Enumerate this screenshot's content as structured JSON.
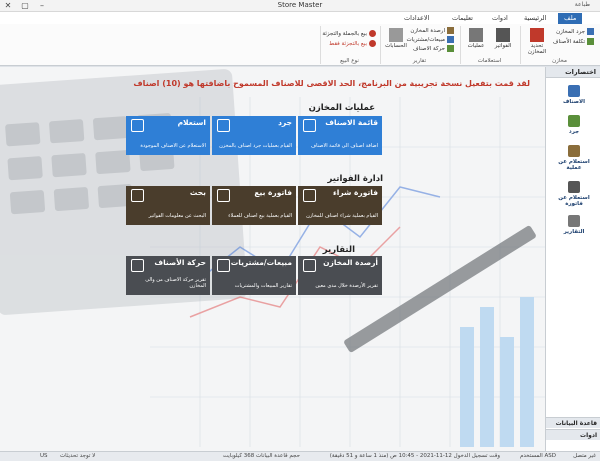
{
  "window": {
    "title": "Store Master",
    "qat": "طباعة"
  },
  "tabs": [
    "ملف",
    "الرئيسية",
    "ادوات",
    "تعليمات",
    "الاعدادات"
  ],
  "ribbon": {
    "groups": [
      {
        "label": "مخازن",
        "items": [
          "جرد المخازن",
          "تكلفة الأصناف"
        ],
        "big": "تحديد المخازن"
      },
      {
        "label": "استعلامات",
        "items": [],
        "big1": "الفواتير",
        "big2": "عمليات"
      },
      {
        "label": "تقارير",
        "items": [
          "ارصدة المخازن",
          "مبيعات/مشتريات",
          "حركة الاصناف"
        ],
        "big": "الحسابات"
      },
      {
        "label": "نوع البيع",
        "items": [
          "بيع بالجملة والتجزئة",
          "بيع بالتجزئة فقط"
        ]
      }
    ]
  },
  "notice": "لقد قمت بتفعيل نسخة تجريبية من البرنامج، الحد الاقصى للاصناف المسموح باضافتها هو (10) اصناف",
  "sections": {
    "store_ops": "عمليات المخازن",
    "invoices": "ادارة الفواتير",
    "reports": "التقارير"
  },
  "tiles": {
    "item_list": {
      "title": "قائمة الاصناف",
      "desc": "اضافة اصناف الى قائمة الاصناف"
    },
    "inventory": {
      "title": "جرد",
      "desc": "القيام بعمليات جرد اصناف بالمخزن"
    },
    "inquiry": {
      "title": "استعلام",
      "desc": "الاستعلام عن الاصناف الموجودة"
    },
    "purchase": {
      "title": "فاتورة شراء",
      "desc": "القيام بعملية شراء اصناف للمخازن"
    },
    "sale": {
      "title": "فاتورة بيع",
      "desc": "القيام بعملية بيع اصناف للعملاء"
    },
    "search": {
      "title": "بحث",
      "desc": "البحث عن معلومات الفواتير"
    },
    "balances": {
      "title": "أرصدة المخازن",
      "desc": "تقرير الأرصدة خلال مدى معين"
    },
    "sales_purchases": {
      "title": "مبيعات/مشتريات",
      "desc": "تقارير المبيعات والمشتريات"
    },
    "movement": {
      "title": "حركة الأصناف",
      "desc": "تقرير حركة الاصناف من والى المخازن"
    }
  },
  "sidebar": {
    "header": "اختصارات",
    "items": [
      "الاصناف",
      "جرد",
      "استعلام عن عملية",
      "استعلام عن فاتورة",
      "التقارير"
    ],
    "bottom1": "قاعدة البيانات",
    "bottom2": "ادوات"
  },
  "status": {
    "user": "المستخدم ASD",
    "login": "وقت تسجيل الدخول 12-11-2021 - 10:45 ص (منذ 1 ساعة و 51 دقيقة)",
    "db": "حجم قاعدة البيانات 368 كيلوبايت",
    "updates": "لا توجد تحديثات",
    "lang": "US",
    "online": "غير متصل"
  },
  "colors": {
    "tile_blue": "#2f7fd6",
    "tile_brown": "#4a3d2c",
    "tile_gray": "#4a4d52",
    "notice": "#c0392b",
    "tab_active": "#2f6db5"
  }
}
